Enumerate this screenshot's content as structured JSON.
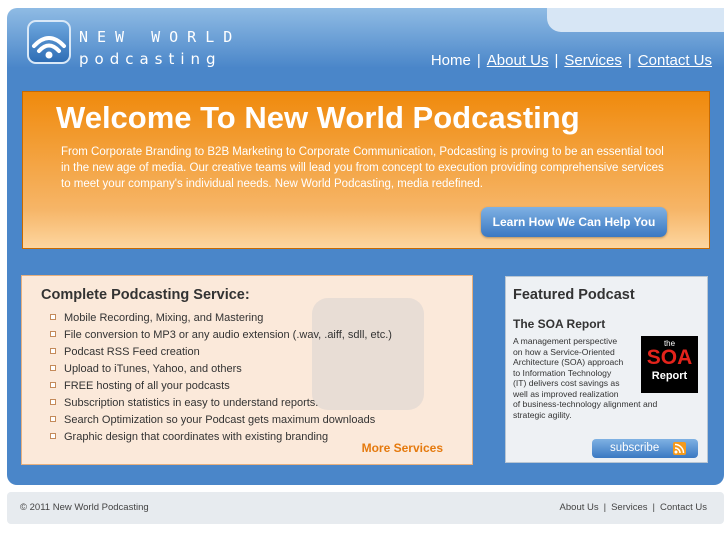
{
  "header": {
    "logo_line1": "NEW WORLD",
    "logo_line2": "podcasting",
    "nav": [
      {
        "label": "Home"
      },
      {
        "label": "About Us"
      },
      {
        "label": "Services"
      },
      {
        "label": "Contact Us"
      }
    ],
    "nav_separator": "|"
  },
  "hero": {
    "title": "Welcome To New World Podcasting",
    "text": "From Corporate Branding to B2B Marketing to Corporate Communication, Podcasting is proving to be an essential tool in the new age of media. Our creative teams will lead you from concept to execution providing comprehensive services to meet your company's individual needs. New World Podcasting, media redefined.",
    "button_label": "Learn How We Can Help You"
  },
  "services": {
    "title": "Complete Podcasting Service:",
    "items": [
      "Mobile Recording, Mixing, and Mastering",
      "File conversion to MP3 or any audio extension (.wav, .aiff, sdll, etc.)",
      "Podcast RSS Feed creation",
      "Upload to iTunes, Yahoo, and others",
      "FREE hosting of all your podcasts",
      "Subscription statistics in easy to understand reports.",
      "Search Optimization so your Podcast gets maximum downloads",
      "Graphic design that coordinates with existing branding"
    ],
    "more_label": "More Services"
  },
  "featured": {
    "title": "Featured Podcast",
    "subtitle": "The SOA Report",
    "desc_lines": [
      "A management perspective",
      "on how a Service-Oriented",
      "Architecture (SOA) approach",
      "to Information Technology",
      "(IT) delivers cost savings as",
      "well as improved realization",
      "of business-technology alignment and",
      "strategic agility."
    ],
    "logo_the": "the",
    "logo_big": "SOA",
    "logo_report": "Report",
    "subscribe_label": "subscribe"
  },
  "footer": {
    "copyright": "© 2011 New World Podcasting",
    "links": [
      {
        "label": "About Us"
      },
      {
        "label": "Services"
      },
      {
        "label": "Contact Us"
      }
    ],
    "separator": "|"
  },
  "colors": {
    "header_blue": "#4a86c9",
    "hero_orange": "#f08a0c",
    "more_services": "#e57a0e",
    "soa_red": "#e3231b"
  }
}
